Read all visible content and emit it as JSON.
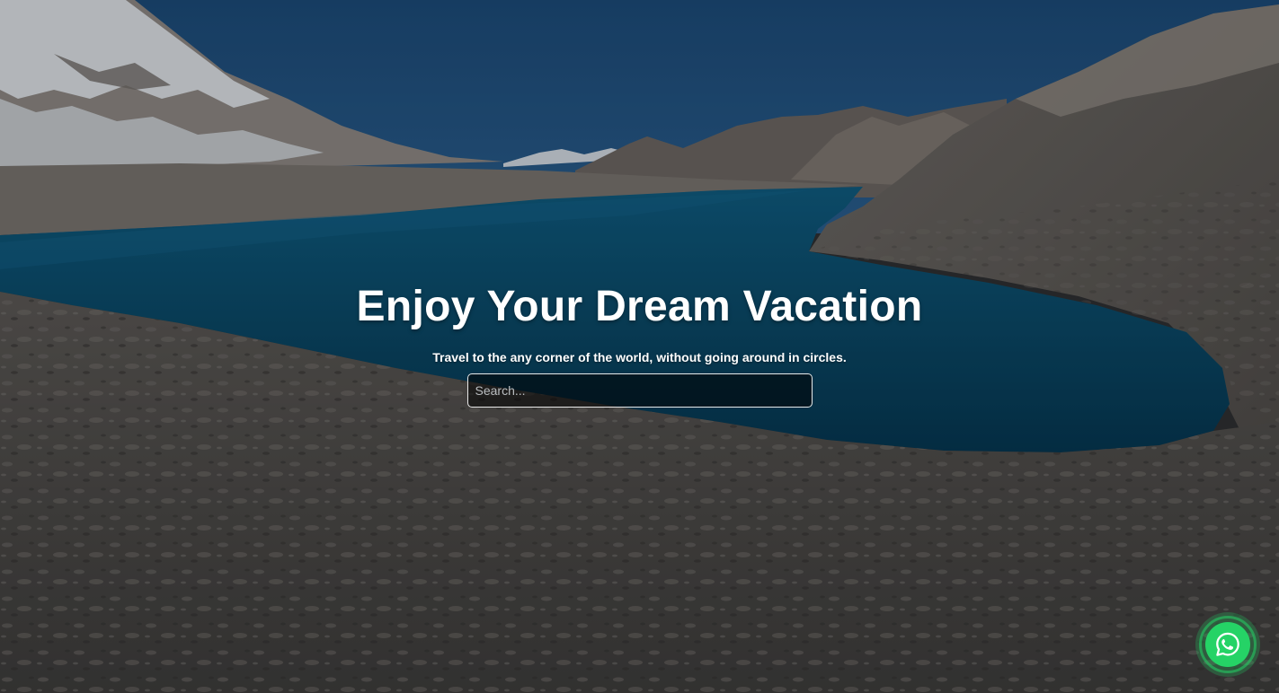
{
  "hero": {
    "title": "Enjoy Your Dream Vacation",
    "subtitle": "Travel to the any corner of the world, without going around in circles.",
    "search_placeholder": "Search...",
    "search_value": "",
    "background_image": "mountain-lake-landscape"
  },
  "whatsapp": {
    "icon": "whatsapp-icon",
    "color": "#25d366"
  },
  "colors": {
    "text": "#ffffff",
    "lake": "#0b4a6b",
    "sky": "#21507e",
    "ground": "#4e4d4b"
  }
}
